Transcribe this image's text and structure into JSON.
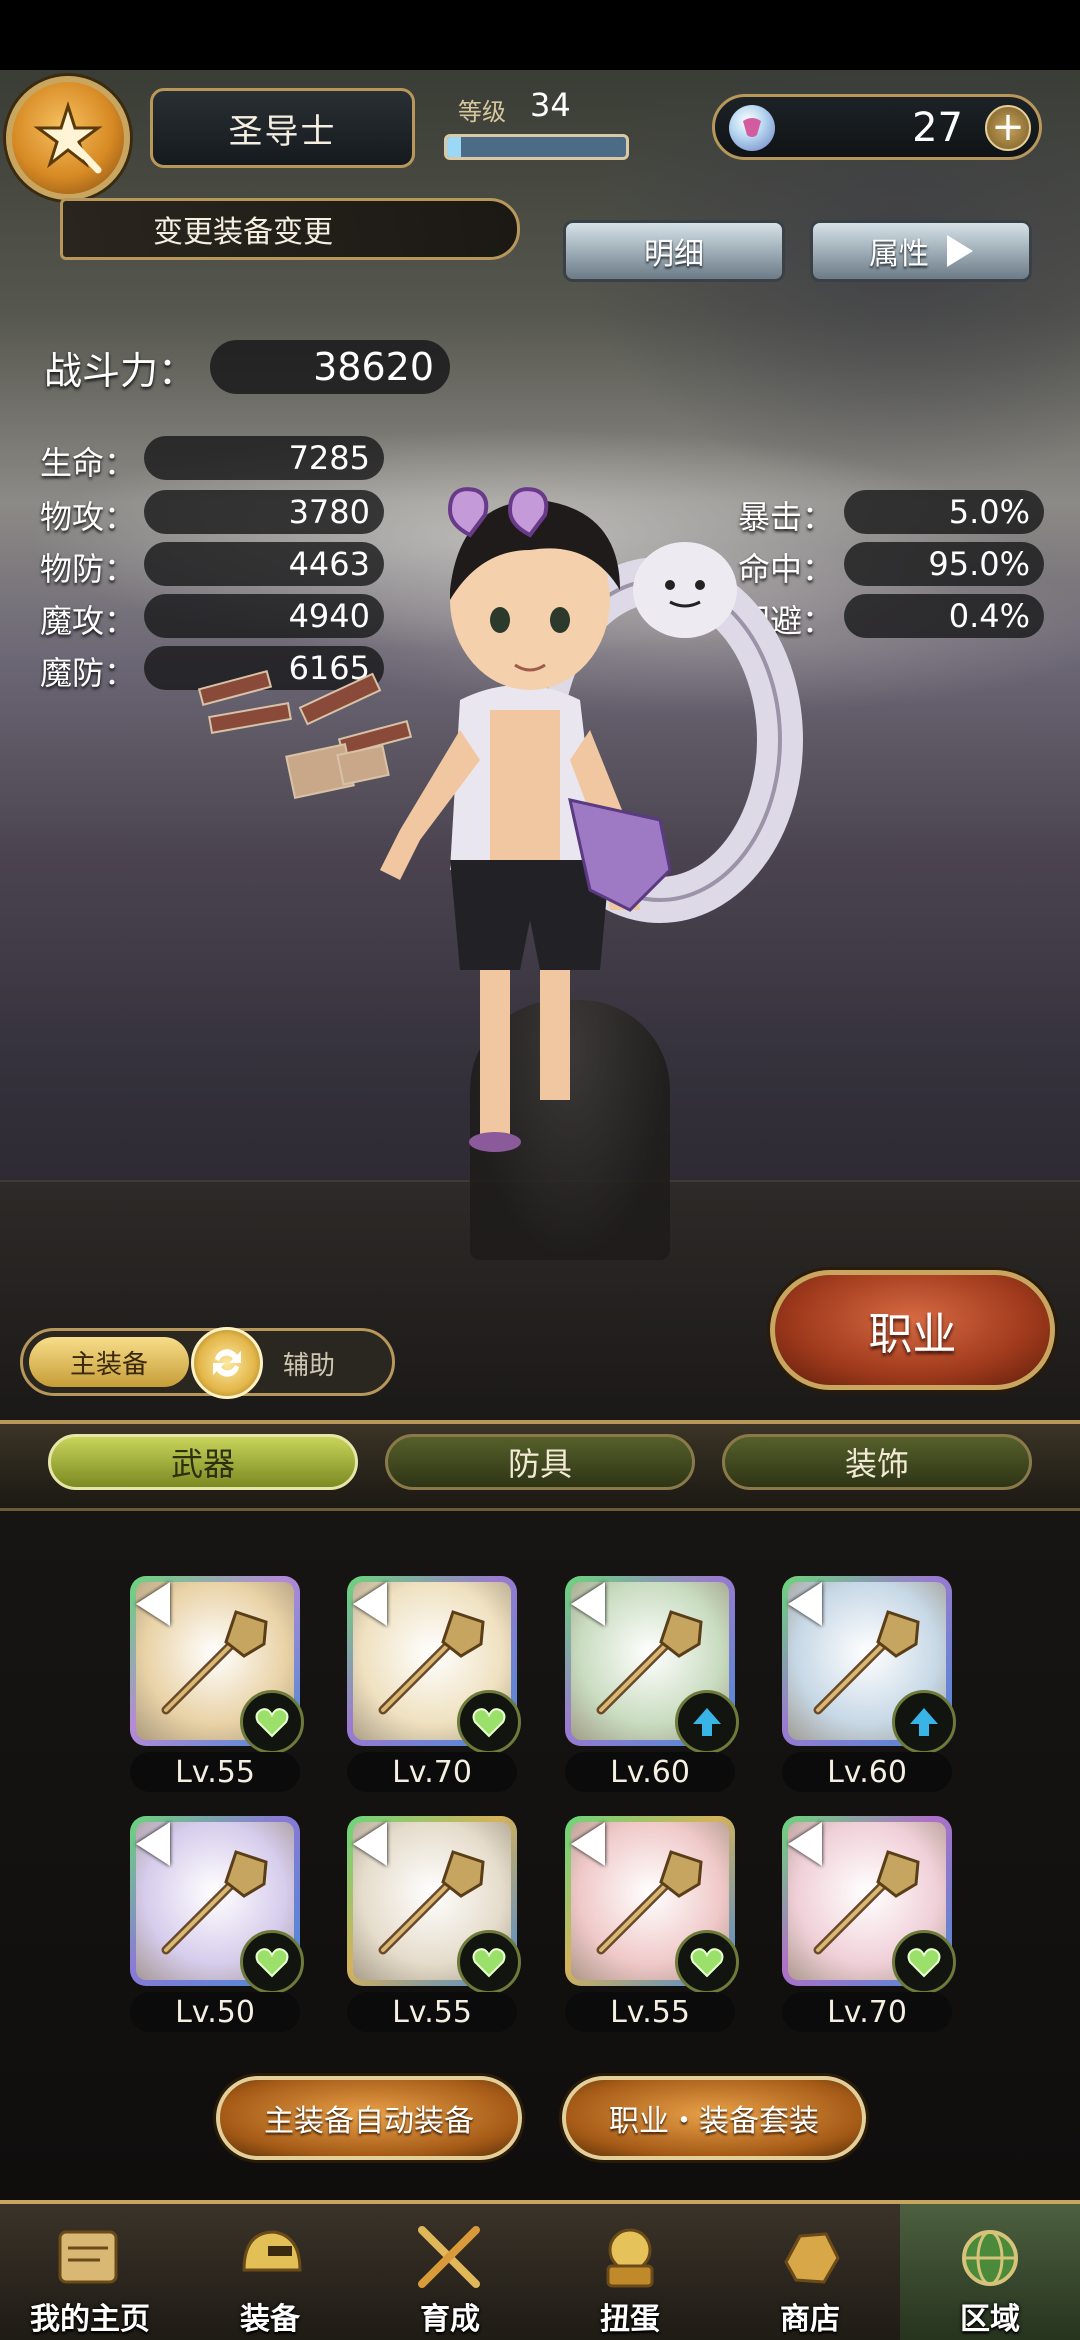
{
  "header": {
    "job_name": "圣导士",
    "level_label": "等级",
    "level_value": "34",
    "level_progress": 0.08,
    "gem_count": "27",
    "gem_plus": "+"
  },
  "change_equipment_label": "变更装备变更",
  "buttons": {
    "detail": "明细",
    "attributes": "属性"
  },
  "power": {
    "label": "战斗力：",
    "value": "38620"
  },
  "stats_left": [
    {
      "label": "生命：",
      "value": "7285"
    },
    {
      "label": "物攻：",
      "value": "3780"
    },
    {
      "label": "物防：",
      "value": "4463"
    },
    {
      "label": "魔攻：",
      "value": "4940"
    },
    {
      "label": "魔防：",
      "value": "6165"
    }
  ],
  "stats_right": [
    {
      "label": "暴击：",
      "value": "5.0%"
    },
    {
      "label": "命中：",
      "value": "95.0%"
    },
    {
      "label": "回避：",
      "value": "0.4%"
    }
  ],
  "job_button": "职业",
  "toggle": {
    "main": "主装备",
    "aux": "辅助"
  },
  "tabs": [
    {
      "label": "武器",
      "active": true
    },
    {
      "label": "防具",
      "active": false
    },
    {
      "label": "装饰",
      "active": false
    }
  ],
  "items": [
    {
      "level": "Lv.55",
      "badge": "heart-icon",
      "frame": "#b58ad6",
      "bg": "#e9d2a6"
    },
    {
      "level": "Lv.70",
      "badge": "heart-icon",
      "frame": "#9b7ad0",
      "bg": "#efe1c0"
    },
    {
      "level": "Lv.60",
      "badge": "upgrade-arrow-icon",
      "frame": "#9b7ad0",
      "bg": "#c9dcc0"
    },
    {
      "level": "Lv.60",
      "badge": "upgrade-arrow-icon",
      "frame": "#9b7ad0",
      "bg": "#c7d8e6"
    },
    {
      "level": "Lv.50",
      "badge": "heart-icon",
      "frame": "#8a7ad6",
      "bg": "#d6ccec"
    },
    {
      "level": "Lv.55",
      "badge": "heart-icon",
      "frame": "#d4b25a",
      "bg": "#e5dccb"
    },
    {
      "level": "Lv.55",
      "badge": "heart-icon",
      "frame": "#d4b25a",
      "bg": "#f0c9c9"
    },
    {
      "level": "Lv.70",
      "badge": "heart-icon",
      "frame": "#b070c8",
      "bg": "#f0d0d8"
    }
  ],
  "actions": {
    "auto_equip": "主装备自动装备",
    "job_set": "职业・装备套装"
  },
  "nav": [
    {
      "label": "我的主页",
      "icon": "scroll-map-icon",
      "active": false
    },
    {
      "label": "装备",
      "icon": "helmet-icon",
      "active": false
    },
    {
      "label": "育成",
      "icon": "crossed-swords-icon",
      "active": false
    },
    {
      "label": "扭蛋",
      "icon": "capsule-machine-icon",
      "active": false
    },
    {
      "label": "商店",
      "icon": "ore-icon",
      "active": false
    },
    {
      "label": "区域",
      "icon": "globe-icon",
      "active": true
    }
  ]
}
